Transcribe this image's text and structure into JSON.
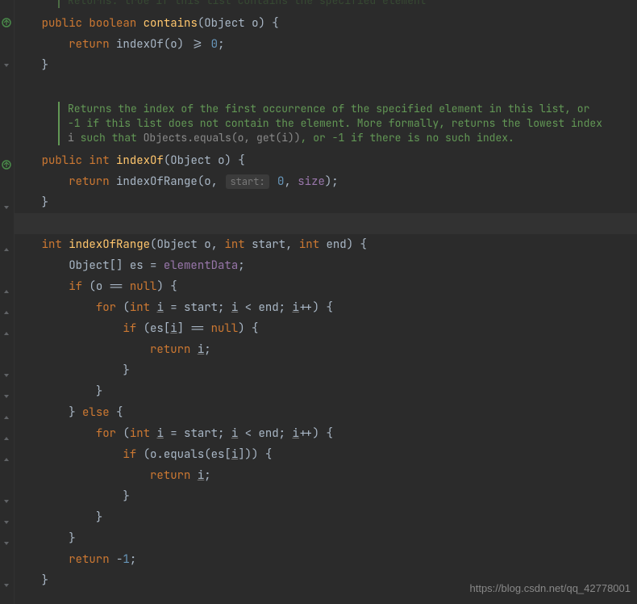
{
  "watermark": "https://blog.csdn.net/qq_42778001",
  "doc1": "Returns: true if this list contains the specified element",
  "doc2_part1": "Returns the index of the first occurrence of the specified element in this list, or -1 if this list does not contain the element. More formally, returns the lowest index ",
  "doc2_code1": "i",
  "doc2_part2": " such that ",
  "doc2_code2": "Objects.equals(o, get(i))",
  "doc2_part3": ", or -1 if there is no such index.",
  "hint_start": "start:",
  "code": {
    "l0": "    public boolean contains(Object o) {",
    "l1": "        return indexOf(o) >= 0;",
    "l2": "    }",
    "l3": "    public int indexOf(Object o) {",
    "l4": "        return indexOfRange(o, ",
    "l4b": " 0, size);",
    "l5": "    }",
    "l6": "    int indexOfRange(Object o, int start, int end) {",
    "l7": "        Object[] es = elementData;",
    "l8": "        if (o == null) {",
    "l9": "            for (int i = start; i < end; i++) {",
    "l10": "                if (es[i] == null) {",
    "l11": "                    return i;",
    "l12": "                }",
    "l13": "            }",
    "l14": "        } else {",
    "l15": "            for (int i = start; i < end; i++) {",
    "l16": "                if (o.equals(es[i])) {",
    "l17": "                    return i;",
    "l18": "                }",
    "l19": "            }",
    "l20": "        }",
    "l21": "        return -1;",
    "l22": "    }"
  }
}
